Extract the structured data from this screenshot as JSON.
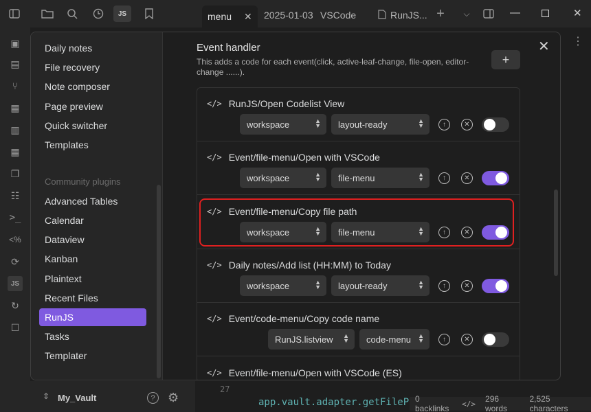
{
  "topbar": {
    "tabs": [
      {
        "label": "menu",
        "active": true
      },
      {
        "label": "2025-01-03"
      },
      {
        "label": "VSCode"
      },
      {
        "label": "RunJS..."
      }
    ],
    "js_label": "JS"
  },
  "sidebar": {
    "core_items": [
      "Daily notes",
      "File recovery",
      "Note composer",
      "Page preview",
      "Quick switcher",
      "Templates"
    ],
    "community_heading": "Community plugins",
    "community_items": [
      "Advanced Tables",
      "Calendar",
      "Dataview",
      "Kanban",
      "Plaintext",
      "Recent Files",
      "RunJS",
      "Tasks",
      "Templater"
    ],
    "active_item": "RunJS"
  },
  "event_handler": {
    "title": "Event handler",
    "description": "This adds a code for each event(click, active-leaf-change, file-open, editor-change ......).",
    "add_label": "+"
  },
  "rows": [
    {
      "title": "RunJS/Open Codelist View",
      "select1": "workspace",
      "select2": "layout-ready",
      "enabled": false
    },
    {
      "title": "Event/file-menu/Open with VSCode",
      "select1": "workspace",
      "select2": "file-menu",
      "enabled": true
    },
    {
      "title": "Event/file-menu/Copy file path",
      "select1": "workspace",
      "select2": "file-menu",
      "enabled": true
    },
    {
      "title": "Daily notes/Add list (HH:MM) to Today",
      "select1": "workspace",
      "select2": "layout-ready",
      "enabled": true
    },
    {
      "title": "Event/code-menu/Copy code name",
      "select1": "RunJS.listview",
      "select2": "code-menu",
      "enabled": false
    },
    {
      "title": "Event/file-menu/Open with VSCode (ES)"
    }
  ],
  "code_icon": "</>",
  "bottom": {
    "vault": "My_Vault",
    "line_number": "27",
    "code_text": "app.vault.adapter.getFilePath",
    "backlinks": "0 backlinks",
    "words": "296 words",
    "characters": "2,525 characters"
  },
  "colors": {
    "accent": "#7f5ae0",
    "highlight": "#e02020"
  }
}
